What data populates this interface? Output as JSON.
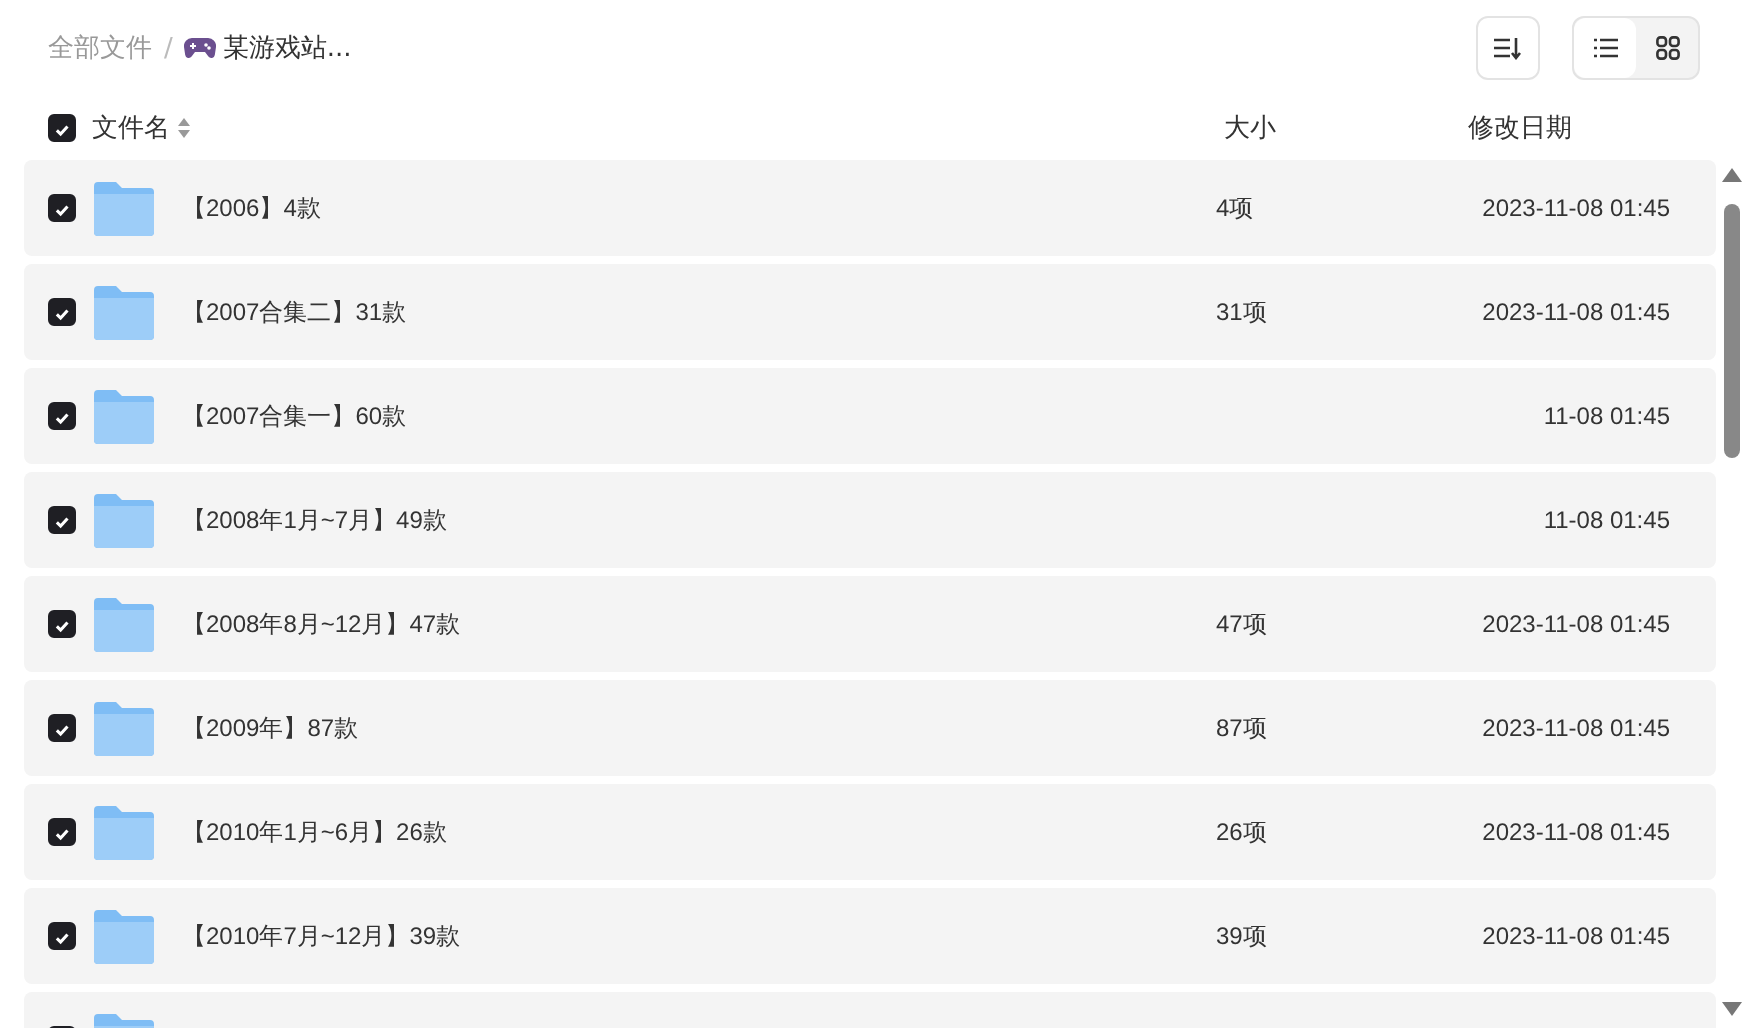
{
  "breadcrumb": {
    "root": "全部文件",
    "separator": "/",
    "current": "某游戏站..."
  },
  "toolbar": {
    "views": [
      {
        "kind": "list",
        "selected": true
      },
      {
        "kind": "grid",
        "selected": false
      }
    ]
  },
  "header": {
    "checked": true,
    "columns": [
      "文件名",
      "大小",
      "修改日期"
    ]
  },
  "rows": [
    {
      "name": "【2006】4款",
      "size": "4项",
      "date": "2023-11-08 01:45",
      "checked": true
    },
    {
      "name": "【2007合集二】31款",
      "size": "31项",
      "date": "2023-11-08 01:45",
      "checked": true
    },
    {
      "name": "【2007合集一】60款",
      "date": "11-08 01:45",
      "checked": true
    },
    {
      "name": "【2008年1月~7月】49款",
      "date": "11-08 01:45",
      "checked": true
    },
    {
      "name": "【2008年8月~12月】47款",
      "size": "47项",
      "date": "2023-11-08 01:45",
      "checked": true
    },
    {
      "name": "【2009年】87款",
      "size": "87项",
      "date": "2023-11-08 01:45",
      "checked": true
    },
    {
      "name": "【2010年1月~6月】26款",
      "size": "26项",
      "date": "2023-11-08 01:45",
      "checked": true
    },
    {
      "name": "【2010年7月~12月】39款",
      "size": "39项",
      "date": "2023-11-08 01:45",
      "checked": true
    },
    {
      "checked": true
    }
  ]
}
